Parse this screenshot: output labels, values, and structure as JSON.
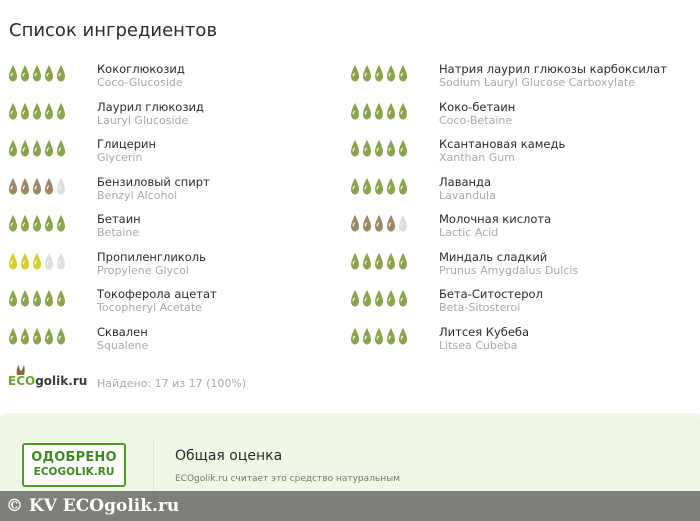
{
  "title": "Список ингредиентов",
  "colors": {
    "green": "#8aa44c",
    "brown": "#9a8a68",
    "yellow": "#d7d02b",
    "empty": "#dedede"
  },
  "ingredients_left": [
    {
      "name": "Кокоглюкозид",
      "latin": "Coco-Glucoside",
      "rating": 5,
      "color": "green"
    },
    {
      "name": "Лаурил глюкозид",
      "latin": "Lauryl Glucoside",
      "rating": 5,
      "color": "green"
    },
    {
      "name": "Глицерин",
      "latin": "Glycerin",
      "rating": 5,
      "color": "green"
    },
    {
      "name": "Бензиловый спирт",
      "latin": "Benzyl Alcohol",
      "rating": 4,
      "color": "brown"
    },
    {
      "name": "Бетаин",
      "latin": "Betaine",
      "rating": 5,
      "color": "green"
    },
    {
      "name": "Пропиленгликоль",
      "latin": "Propylene Glycol",
      "rating": 3,
      "color": "yellow"
    },
    {
      "name": "Токоферола ацетат",
      "latin": "Tocopheryl Acetate",
      "rating": 5,
      "color": "green"
    },
    {
      "name": "Сквален",
      "latin": "Squalene",
      "rating": 5,
      "color": "green"
    }
  ],
  "ingredients_right": [
    {
      "name": "Натрия лаурил глюкозы карбоксилат",
      "latin": "Sodium Lauryl Glucose Carboxylate",
      "rating": 5,
      "color": "green"
    },
    {
      "name": "Коко-бетаин",
      "latin": "Coco-Betaine",
      "rating": 5,
      "color": "green"
    },
    {
      "name": "Ксантановая камедь",
      "latin": "Xanthan Gum",
      "rating": 5,
      "color": "green"
    },
    {
      "name": "Лаванда",
      "latin": "Lavandula",
      "rating": 5,
      "color": "green"
    },
    {
      "name": "Молочная кислота",
      "latin": "Lactic Acid",
      "rating": 4,
      "color": "brown"
    },
    {
      "name": "Миндаль сладкий",
      "latin": "Prunus Amygdalus Dulcis",
      "rating": 5,
      "color": "green"
    },
    {
      "name": "Бета-Ситостерол",
      "latin": "Beta-Sitosterol",
      "rating": 5,
      "color": "green"
    },
    {
      "name": "Литсея Кубеба",
      "latin": "Litsea Cubeba",
      "rating": 5,
      "color": "green"
    }
  ],
  "logo": {
    "eco": "ECO",
    "rest": "golik.ru"
  },
  "found_text": "Найдено: 17 из 17 (100%)",
  "stamp": {
    "line1": "ОДОБРЕНО",
    "line2": "ECOGOLIK.RU"
  },
  "overall": {
    "title": "Общая оценка",
    "description": "ECOgolik.ru считает это средство натуральным"
  },
  "watermark": "© KV ECOgolik.ru"
}
